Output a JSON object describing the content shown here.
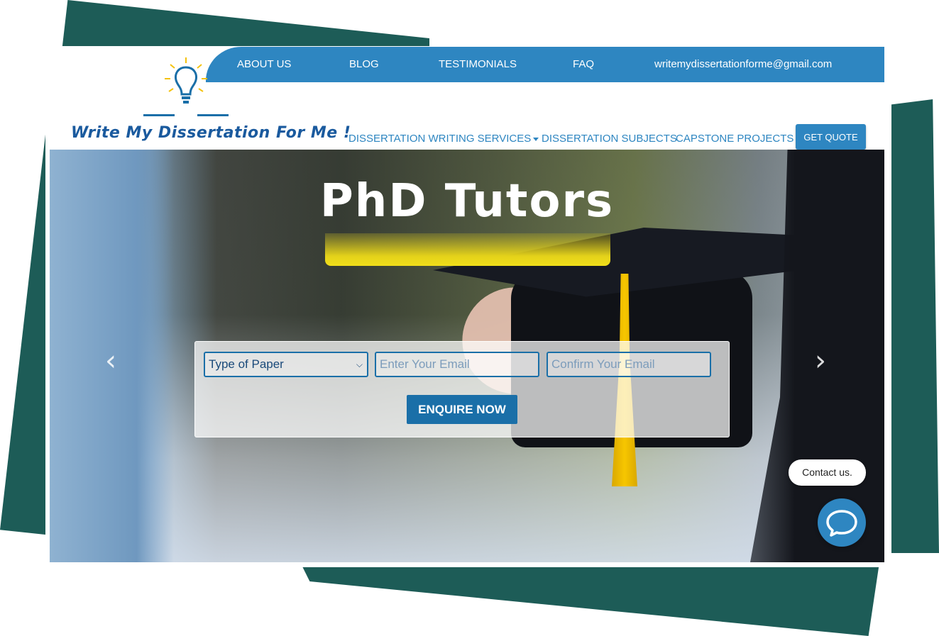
{
  "topnav": {
    "items": [
      "ABOUT US",
      "BLOG",
      "TESTIMONIALS",
      "FAQ"
    ],
    "email": "writemydissertationforme@gmail.com"
  },
  "logo": {
    "text": "Write My Dissertation For Me !"
  },
  "subnav": {
    "items": [
      "DISSERTATION WRITING SERVICES",
      "DISSERTATION SUBJECTS",
      "CAPSTONE PROJECTS"
    ],
    "quote_label": "GET QUOTE"
  },
  "hero": {
    "title": "PhD Tutors",
    "prev_arrow": "‹",
    "next_arrow": "›"
  },
  "form": {
    "paper_type": "Type of Paper",
    "email_placeholder": "Enter Your Email",
    "confirm_placeholder": "Confirm Your Email",
    "submit_label": "ENQUIRE NOW"
  },
  "chat": {
    "contact_label": "Contact us."
  },
  "colors": {
    "brand_blue": "#2e86c1",
    "dark_blue": "#1a6fa8",
    "backdrop_teal": "#1d5c57",
    "accent_yellow": "#f0de1a"
  },
  "icons": {
    "logo": "lightbulb-icon",
    "dropdown": "caret-down-icon",
    "chat": "chat-bubble-icon",
    "prev": "chevron-left-icon",
    "next": "chevron-right-icon"
  }
}
